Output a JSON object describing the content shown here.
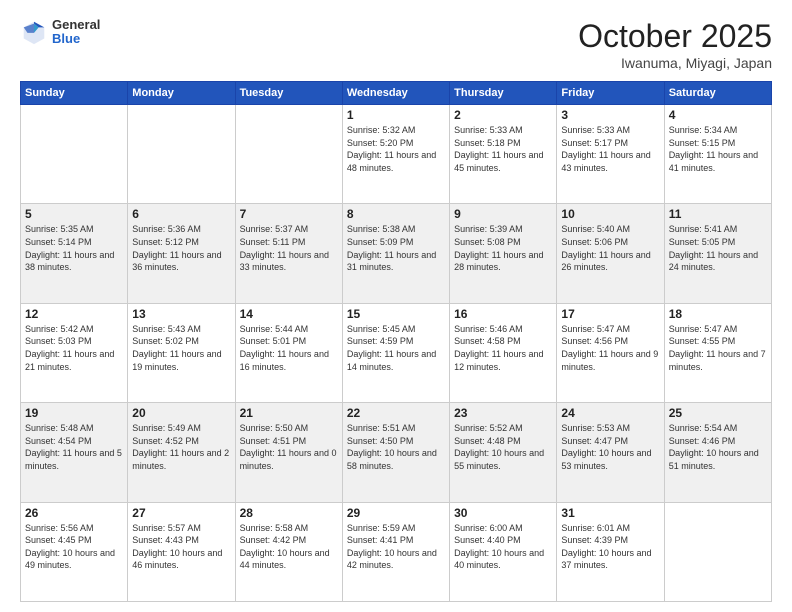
{
  "header": {
    "logo_general": "General",
    "logo_blue": "Blue",
    "month": "October 2025",
    "location": "Iwanuma, Miyagi, Japan"
  },
  "weekdays": [
    "Sunday",
    "Monday",
    "Tuesday",
    "Wednesday",
    "Thursday",
    "Friday",
    "Saturday"
  ],
  "rows": [
    [
      {
        "day": "",
        "info": ""
      },
      {
        "day": "",
        "info": ""
      },
      {
        "day": "",
        "info": ""
      },
      {
        "day": "1",
        "info": "Sunrise: 5:32 AM\nSunset: 5:20 PM\nDaylight: 11 hours and 48 minutes."
      },
      {
        "day": "2",
        "info": "Sunrise: 5:33 AM\nSunset: 5:18 PM\nDaylight: 11 hours and 45 minutes."
      },
      {
        "day": "3",
        "info": "Sunrise: 5:33 AM\nSunset: 5:17 PM\nDaylight: 11 hours and 43 minutes."
      },
      {
        "day": "4",
        "info": "Sunrise: 5:34 AM\nSunset: 5:15 PM\nDaylight: 11 hours and 41 minutes."
      }
    ],
    [
      {
        "day": "5",
        "info": "Sunrise: 5:35 AM\nSunset: 5:14 PM\nDaylight: 11 hours and 38 minutes."
      },
      {
        "day": "6",
        "info": "Sunrise: 5:36 AM\nSunset: 5:12 PM\nDaylight: 11 hours and 36 minutes."
      },
      {
        "day": "7",
        "info": "Sunrise: 5:37 AM\nSunset: 5:11 PM\nDaylight: 11 hours and 33 minutes."
      },
      {
        "day": "8",
        "info": "Sunrise: 5:38 AM\nSunset: 5:09 PM\nDaylight: 11 hours and 31 minutes."
      },
      {
        "day": "9",
        "info": "Sunrise: 5:39 AM\nSunset: 5:08 PM\nDaylight: 11 hours and 28 minutes."
      },
      {
        "day": "10",
        "info": "Sunrise: 5:40 AM\nSunset: 5:06 PM\nDaylight: 11 hours and 26 minutes."
      },
      {
        "day": "11",
        "info": "Sunrise: 5:41 AM\nSunset: 5:05 PM\nDaylight: 11 hours and 24 minutes."
      }
    ],
    [
      {
        "day": "12",
        "info": "Sunrise: 5:42 AM\nSunset: 5:03 PM\nDaylight: 11 hours and 21 minutes."
      },
      {
        "day": "13",
        "info": "Sunrise: 5:43 AM\nSunset: 5:02 PM\nDaylight: 11 hours and 19 minutes."
      },
      {
        "day": "14",
        "info": "Sunrise: 5:44 AM\nSunset: 5:01 PM\nDaylight: 11 hours and 16 minutes."
      },
      {
        "day": "15",
        "info": "Sunrise: 5:45 AM\nSunset: 4:59 PM\nDaylight: 11 hours and 14 minutes."
      },
      {
        "day": "16",
        "info": "Sunrise: 5:46 AM\nSunset: 4:58 PM\nDaylight: 11 hours and 12 minutes."
      },
      {
        "day": "17",
        "info": "Sunrise: 5:47 AM\nSunset: 4:56 PM\nDaylight: 11 hours and 9 minutes."
      },
      {
        "day": "18",
        "info": "Sunrise: 5:47 AM\nSunset: 4:55 PM\nDaylight: 11 hours and 7 minutes."
      }
    ],
    [
      {
        "day": "19",
        "info": "Sunrise: 5:48 AM\nSunset: 4:54 PM\nDaylight: 11 hours and 5 minutes."
      },
      {
        "day": "20",
        "info": "Sunrise: 5:49 AM\nSunset: 4:52 PM\nDaylight: 11 hours and 2 minutes."
      },
      {
        "day": "21",
        "info": "Sunrise: 5:50 AM\nSunset: 4:51 PM\nDaylight: 11 hours and 0 minutes."
      },
      {
        "day": "22",
        "info": "Sunrise: 5:51 AM\nSunset: 4:50 PM\nDaylight: 10 hours and 58 minutes."
      },
      {
        "day": "23",
        "info": "Sunrise: 5:52 AM\nSunset: 4:48 PM\nDaylight: 10 hours and 55 minutes."
      },
      {
        "day": "24",
        "info": "Sunrise: 5:53 AM\nSunset: 4:47 PM\nDaylight: 10 hours and 53 minutes."
      },
      {
        "day": "25",
        "info": "Sunrise: 5:54 AM\nSunset: 4:46 PM\nDaylight: 10 hours and 51 minutes."
      }
    ],
    [
      {
        "day": "26",
        "info": "Sunrise: 5:56 AM\nSunset: 4:45 PM\nDaylight: 10 hours and 49 minutes."
      },
      {
        "day": "27",
        "info": "Sunrise: 5:57 AM\nSunset: 4:43 PM\nDaylight: 10 hours and 46 minutes."
      },
      {
        "day": "28",
        "info": "Sunrise: 5:58 AM\nSunset: 4:42 PM\nDaylight: 10 hours and 44 minutes."
      },
      {
        "day": "29",
        "info": "Sunrise: 5:59 AM\nSunset: 4:41 PM\nDaylight: 10 hours and 42 minutes."
      },
      {
        "day": "30",
        "info": "Sunrise: 6:00 AM\nSunset: 4:40 PM\nDaylight: 10 hours and 40 minutes."
      },
      {
        "day": "31",
        "info": "Sunrise: 6:01 AM\nSunset: 4:39 PM\nDaylight: 10 hours and 37 minutes."
      },
      {
        "day": "",
        "info": ""
      }
    ]
  ],
  "row_shading": [
    false,
    true,
    false,
    true,
    false
  ]
}
